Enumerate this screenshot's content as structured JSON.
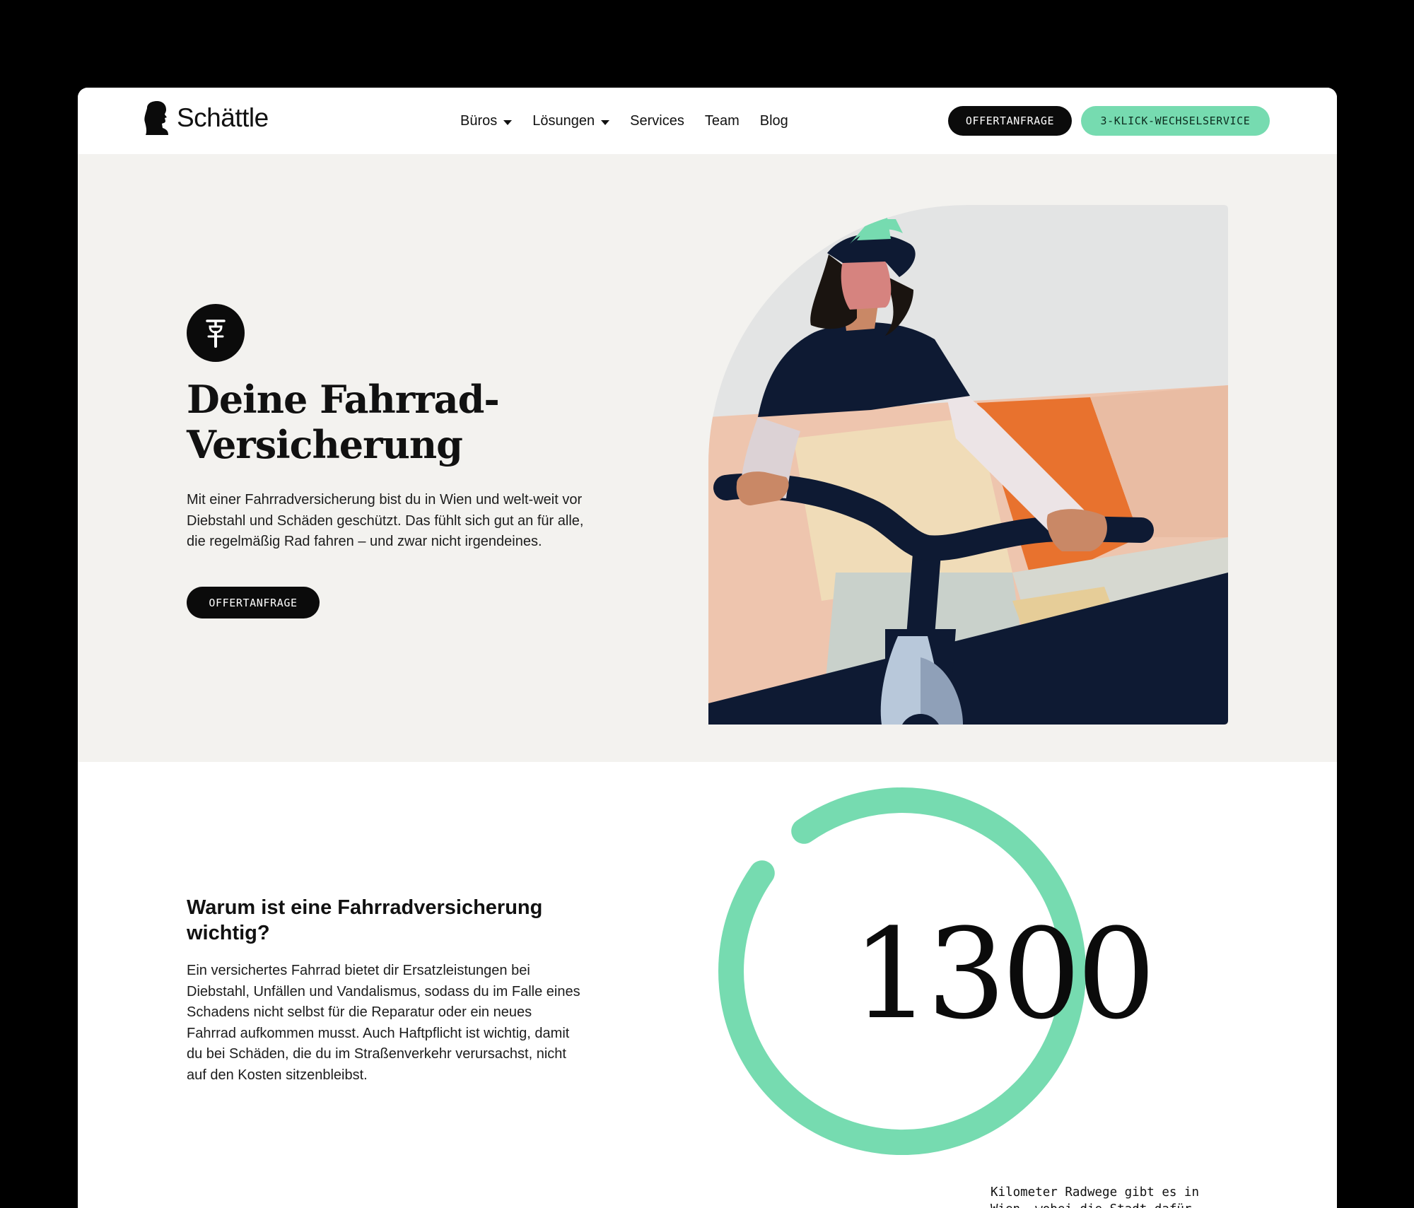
{
  "brand": {
    "name": "Schättle"
  },
  "nav": {
    "items": [
      {
        "label": "Büros",
        "has_dropdown": true
      },
      {
        "label": "Lösungen",
        "has_dropdown": true
      },
      {
        "label": "Services",
        "has_dropdown": false
      },
      {
        "label": "Team",
        "has_dropdown": false
      },
      {
        "label": "Blog",
        "has_dropdown": false
      }
    ],
    "cta_primary": "OFFERTANFRAGE",
    "cta_secondary": "3-KLICK-WECHSELSERVICE"
  },
  "hero": {
    "icon": "bicycle-icon",
    "title_line1": "Deine Fahrrad-",
    "title_line2": "Versicherung",
    "text": "Mit einer Fahrradversicherung bist du in Wien und welt-weit vor Diebstahl und Schäden geschützt. Das fühlt sich gut an für alle, die regelmäßig Rad fahren – und zwar nicht irgendeines.",
    "cta": "OFFERTANFRAGE",
    "illustration": "woman-on-bicycle-illustration"
  },
  "why": {
    "title": "Warum ist eine Fahrradversicherung wichtig?",
    "text": "Ein versichertes Fahrrad bietet dir Ersatzleistungen bei Diebstahl, Unfällen und Vandalismus, sodass du im Falle eines Schadens nicht selbst für die Reparatur oder ein neues Fahrrad aufkommen musst. Auch Haftpflicht ist wichtig, damit du bei Schäden, die du im Straßenverkehr verursachst, nicht auf den Kosten sitzenbleibst."
  },
  "stat": {
    "value": "1300",
    "text": "Kilometer Radwege gibt es in Wien, wobei die Stadt dafür bekannt ist, zu Leuten am Rad besonders unfreundlich zu sein."
  },
  "colors": {
    "accent": "#76dbb0",
    "dark": "#0b0b0b",
    "hero_bg": "#f3f2ef",
    "navy": "#0e1a33",
    "orange": "#e8722e",
    "peach": "#ecc3ad"
  }
}
